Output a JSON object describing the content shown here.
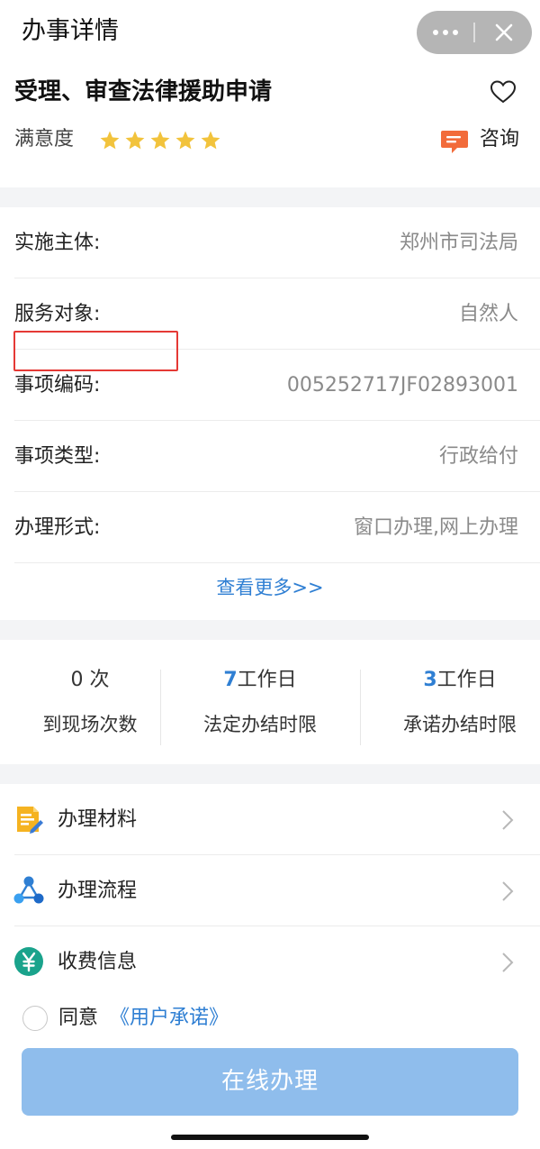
{
  "header": {
    "title": "办事详情",
    "capsule": {
      "more_icon": "more-dots-icon",
      "close_icon": "close-icon"
    }
  },
  "item": {
    "title": "受理、审查法律援助申请",
    "favorite_icon": "heart-icon",
    "satisfaction_label": "满意度",
    "rating": 5,
    "rating_max": 5,
    "consult_label": "咨询"
  },
  "info": {
    "rows": [
      {
        "label": "实施主体:",
        "value": "郑州市司法局"
      },
      {
        "label": "服务对象:",
        "value": "自然人"
      },
      {
        "label": "事项编码:",
        "value": "005252717JF02893001"
      },
      {
        "label": "事项类型:",
        "value": "行政给付"
      },
      {
        "label": "办理形式:",
        "value": "窗口办理,网上办理"
      }
    ],
    "view_more": "查看更多>>"
  },
  "stats": [
    {
      "num": "0",
      "unit": " 次",
      "desc": "到现场次数"
    },
    {
      "num": "7",
      "unit": "工作日",
      "desc": "法定办结时限"
    },
    {
      "num": "3",
      "unit": "工作日",
      "desc": "承诺办结时限"
    }
  ],
  "menu": [
    {
      "label": "办理材料",
      "icon": "document-icon"
    },
    {
      "label": "办理流程",
      "icon": "process-icon"
    },
    {
      "label": "收费信息",
      "icon": "yuan-icon"
    }
  ],
  "agreement": {
    "prefix": "同意",
    "link": "《用户承诺》"
  },
  "submit_label": "在线办理",
  "colors": {
    "accent": "#2f7fd3",
    "star": "#f2c33c",
    "button": "#8fbdec",
    "consult": "#f26b3a",
    "highlight": "#e53935"
  }
}
